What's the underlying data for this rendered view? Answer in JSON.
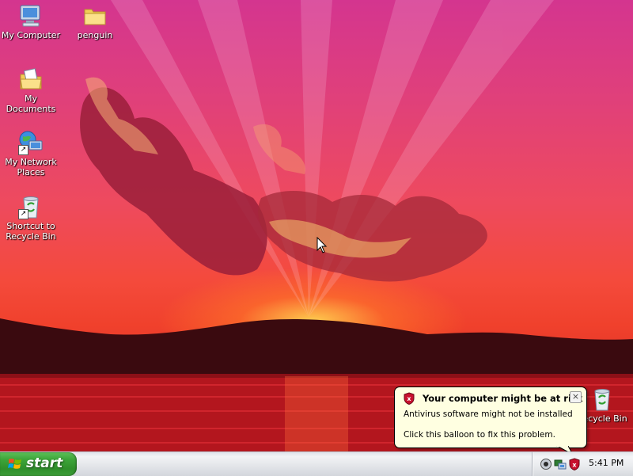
{
  "desktop": {
    "icons": [
      {
        "label": "My Computer",
        "icon": "my-computer-icon"
      },
      {
        "label": "penguin",
        "icon": "folder-icon"
      },
      {
        "label": "My Documents",
        "icon": "my-documents-icon"
      },
      {
        "label": "My Network Places",
        "icon": "network-places-icon"
      },
      {
        "label": "Shortcut to Recycle Bin",
        "icon": "recycle-bin-icon"
      },
      {
        "label": "Recycle Bin",
        "icon": "recycle-bin-icon"
      }
    ]
  },
  "balloon": {
    "title": "Your computer might be at risk",
    "line1": "Antivirus software might not be installed",
    "line2": "Click this balloon to fix this problem.",
    "close": "×",
    "icon": "security-shield-icon"
  },
  "taskbar": {
    "start_label": "start",
    "clock": "5:41 PM",
    "tray_icons": [
      "audio-icon",
      "network-icon",
      "security-shield-icon"
    ]
  },
  "colors": {
    "balloon_bg": "#ffffe1",
    "start_green": "#3da53a",
    "shield_red": "#c8102e"
  }
}
